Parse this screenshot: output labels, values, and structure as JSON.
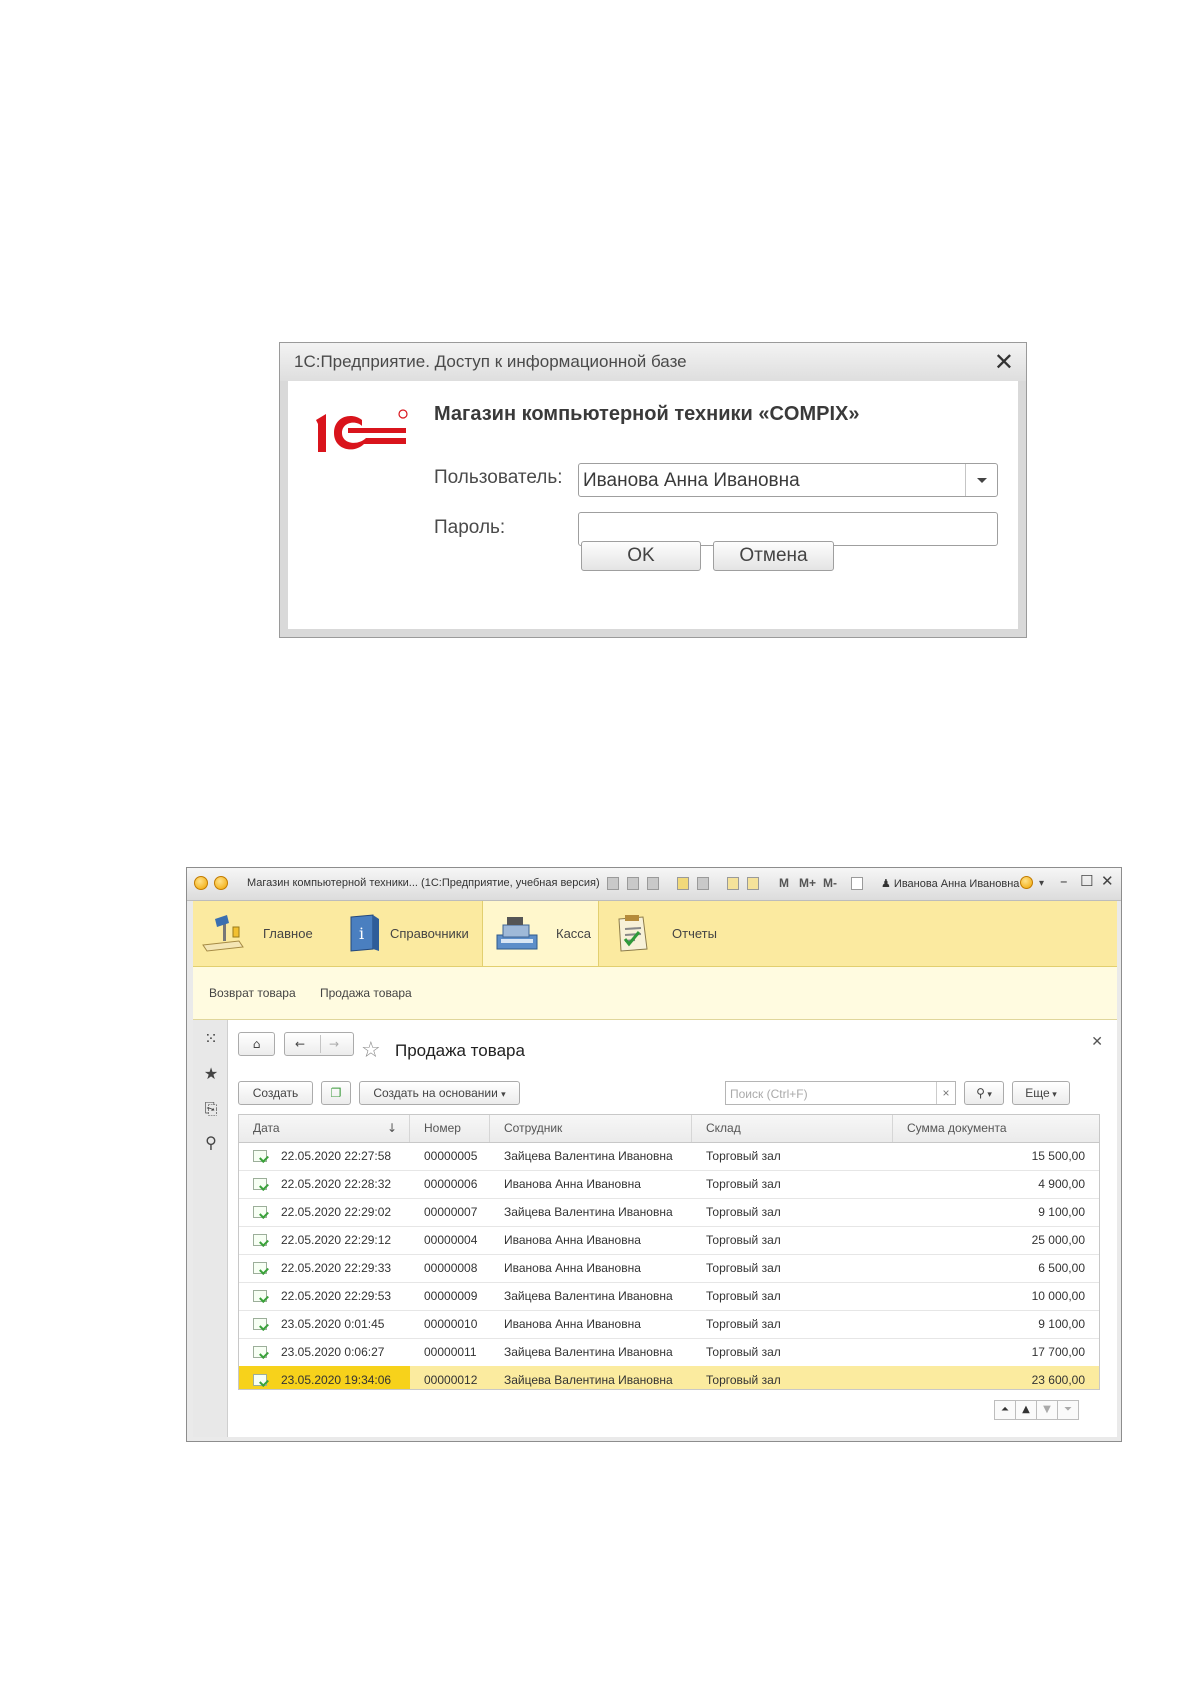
{
  "login_dialog": {
    "title": "1С:Предприятие. Доступ к информационной базе",
    "logo_text": "1С",
    "app_title": "Магазин компьютерной техники «COMPIX»",
    "user_label": "Пользователь:",
    "user_value": "Иванова Анна Ивановна",
    "password_label": "Пароль:",
    "password_value": "",
    "ok_label": "OK",
    "cancel_label": "Отмена"
  },
  "main_window": {
    "title": "Магазин компьютерной техники... (1С:Предприятие, учебная версия)",
    "toolbar_text": {
      "m": "M",
      "mplus": "M+",
      "mminus": "M-"
    },
    "user_name": "Иванова Анна Ивановна",
    "sections": [
      {
        "label": "Главное",
        "icon": "desk-lamp-icon"
      },
      {
        "label": "Справочники",
        "icon": "book-icon"
      },
      {
        "label": "Касса",
        "icon": "cash-register-icon",
        "active": true
      },
      {
        "label": "Отчеты",
        "icon": "clipboard-icon"
      }
    ],
    "nav_links": [
      "Возврат товара",
      "Продажа товара"
    ],
    "form_title": "Продажа товара",
    "buttons": {
      "create": "Создать",
      "create_based_on": "Создать на основании",
      "more": "Еще"
    },
    "search_placeholder": "Поиск (Ctrl+F)",
    "columns": [
      "Дата",
      "Номер",
      "Сотрудник",
      "Склад",
      "Сумма документа"
    ],
    "rows": [
      {
        "date": "22.05.2020 22:27:58",
        "number": "00000005",
        "employee": "Зайцева Валентина Ивановна",
        "warehouse": "Торговый зал",
        "sum": "15 500,00"
      },
      {
        "date": "22.05.2020 22:28:32",
        "number": "00000006",
        "employee": "Иванова Анна Ивановна",
        "warehouse": "Торговый зал",
        "sum": "4 900,00"
      },
      {
        "date": "22.05.2020 22:29:02",
        "number": "00000007",
        "employee": "Зайцева Валентина Ивановна",
        "warehouse": "Торговый зал",
        "sum": "9 100,00"
      },
      {
        "date": "22.05.2020 22:29:12",
        "number": "00000004",
        "employee": "Иванова Анна Ивановна",
        "warehouse": "Торговый зал",
        "sum": "25 000,00"
      },
      {
        "date": "22.05.2020 22:29:33",
        "number": "00000008",
        "employee": "Иванова Анна Ивановна",
        "warehouse": "Торговый зал",
        "sum": "6 500,00"
      },
      {
        "date": "22.05.2020 22:29:53",
        "number": "00000009",
        "employee": "Зайцева Валентина Ивановна",
        "warehouse": "Торговый зал",
        "sum": "10 000,00"
      },
      {
        "date": "23.05.2020 0:01:45",
        "number": "00000010",
        "employee": "Иванова Анна Ивановна",
        "warehouse": "Торговый зал",
        "sum": "9 100,00"
      },
      {
        "date": "23.05.2020 0:06:27",
        "number": "00000011",
        "employee": "Зайцева Валентина Ивановна",
        "warehouse": "Торговый зал",
        "sum": "17 700,00"
      },
      {
        "date": "23.05.2020 19:34:06",
        "number": "00000012",
        "employee": "Зайцева Валентина Ивановна",
        "warehouse": "Торговый зал",
        "sum": "23 600,00",
        "selected": true
      }
    ]
  },
  "colors": {
    "logo_red": "#d9141c",
    "section_bg": "#fbeaa0",
    "selected_row": "#fbeb9f",
    "selected_cell": "#f7d21b"
  }
}
